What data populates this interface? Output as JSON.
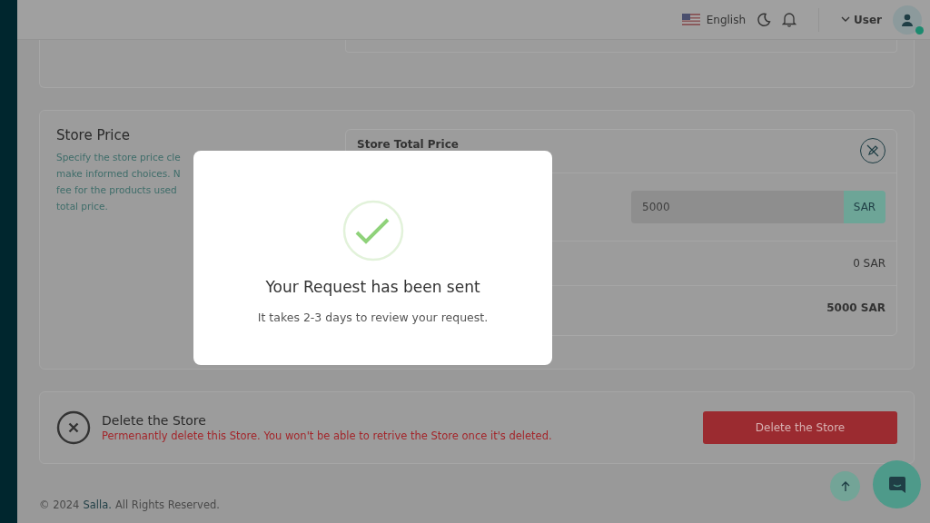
{
  "header": {
    "language": "English",
    "user": "User",
    "user_online": true
  },
  "store_price": {
    "title": "Store Price",
    "description_lines": [
      "Specify the store price cle",
      "make informed choices. N",
      "fee for the products used",
      "total price."
    ],
    "panel": {
      "title": "Store Total Price",
      "price_field": {
        "value": "5000",
        "unit": "SAR"
      },
      "rows": [
        {
          "value": "0 SAR",
          "bold": false
        },
        {
          "value": "5000 SAR",
          "bold": true
        }
      ]
    }
  },
  "delete_store": {
    "title": "Delete the Store",
    "warning": "Permenantly delete this Store. You won't be able to retrive the Store once it's deleted.",
    "button": "Delete the Store"
  },
  "footer": {
    "copyright": "© 2024",
    "brand": "Salla.",
    "rights": "All Rights Reserved."
  },
  "modal": {
    "title": "Your Request has been sent",
    "message": "It takes 2-3 days to review your request."
  }
}
